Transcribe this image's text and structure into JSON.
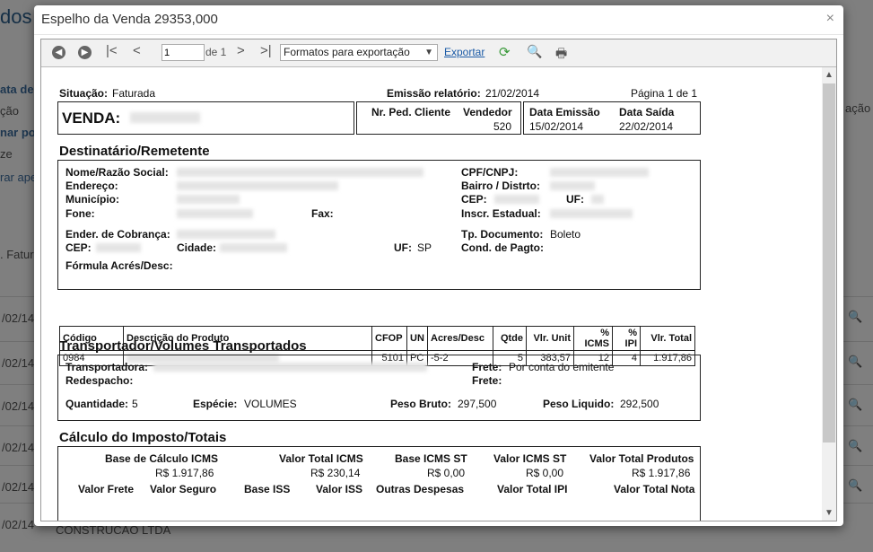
{
  "background": {
    "title": "dos",
    "side_links": [
      "ata de",
      "ção",
      "nar po",
      "ze",
      "rar ape"
    ],
    "filter_text": ". Fatur",
    "row_dates": [
      "/02/14",
      "/02/14",
      "/02/14",
      "/02/14",
      "/02/14",
      "/02/14"
    ],
    "footer_row": "CONSTRUCAO LTDA",
    "right_link": "ação"
  },
  "modal": {
    "title": "Espelho da Venda 29353,000",
    "close_icon": "×"
  },
  "toolbar": {
    "page_value": "1",
    "page_of": "de 1",
    "export_format": "Formatos para exportação",
    "export_label": "Exportar"
  },
  "report": {
    "situacao_label": "Situação:",
    "situacao_value": "Faturada",
    "emissao_rel_label": "Emissão relatório:",
    "emissao_rel_value": "21/02/2014",
    "pagina": "Página 1 de 1",
    "venda_label": "VENDA:",
    "nr_ped_label": "Nr. Ped. Cliente",
    "vendedor_label": "Vendedor",
    "vendedor_value": "520",
    "data_emissao_label": "Data Emissão",
    "data_emissao_value": "15/02/2014",
    "data_saida_label": "Data Saída",
    "data_saida_value": "22/02/2014",
    "sec_destinatario": "Destinatário/Remetente",
    "dest": {
      "nome": "Nome/Razão Social:",
      "endereco": "Endereço:",
      "municipio": "Município:",
      "fone": "Fone:",
      "fax": "Fax:",
      "cnpj": "CPF/CNPJ:",
      "bairro": "Bairro / Distrto:",
      "cep": "CEP:",
      "uf": "UF:",
      "ie": "Inscr. Estadual:",
      "ender_cobranca": "Ender. de Cobrança:",
      "cep2": "CEP:",
      "cidade": "Cidade:",
      "uf2": "UF:",
      "uf2_value": "SP",
      "tp_doc": "Tp. Documento:",
      "tp_doc_value": "Boleto",
      "cond_pagto": "Cond. de Pagto:",
      "formula": "Fórmula Acrés/Desc:"
    },
    "product_headers": [
      "Código",
      "Descrição do Produto",
      "CFOP",
      "UN",
      "Acres/Desc",
      "Qtde",
      "Vlr. Unit",
      "% ICMS",
      "% IPI",
      "Vlr. Total"
    ],
    "product_row": [
      "0984",
      "",
      "5101",
      "PC",
      "-5-2",
      "5",
      "383,57",
      "12",
      "4",
      "1.917,86"
    ],
    "sec_transportador": "Transportador/Volumes Transportados",
    "transp": {
      "transportadora": "Transportadora:",
      "redespacho": "Redespacho:",
      "frete1": "Frete:",
      "frete1_value": "Por conta do emitente",
      "frete2": "Frete:",
      "quantidade": "Quantidade:",
      "quantidade_value": "5",
      "especie": "Espécie:",
      "especie_value": "VOLUMES",
      "peso_bruto": "Peso Bruto:",
      "peso_bruto_value": "297,500",
      "peso_liquido": "Peso Liquido:",
      "peso_liquido_value": "292,500"
    },
    "sec_imposto": "Cálculo do Imposto/Totais",
    "totais": {
      "base_icms": "Base de Cálculo ICMS",
      "base_icms_value": "R$ 1.917,86",
      "valor_icms": "Valor Total ICMS",
      "valor_icms_value": "R$ 230,14",
      "base_st": "Base ICMS ST",
      "base_st_value": "R$ 0,00",
      "valor_st": "Valor ICMS ST",
      "valor_st_value": "R$ 0,00",
      "valor_produtos": "Valor Total Produtos",
      "valor_produtos_value": "R$ 1.917,86",
      "valor_frete": "Valor Frete",
      "valor_seguro": "Valor Seguro",
      "base_iss": "Base ISS",
      "valor_iss": "Valor ISS",
      "outras_despesas": "Outras Despesas",
      "valor_ipi": "Valor Total IPI",
      "valor_nota": "Valor Total Nota"
    }
  }
}
